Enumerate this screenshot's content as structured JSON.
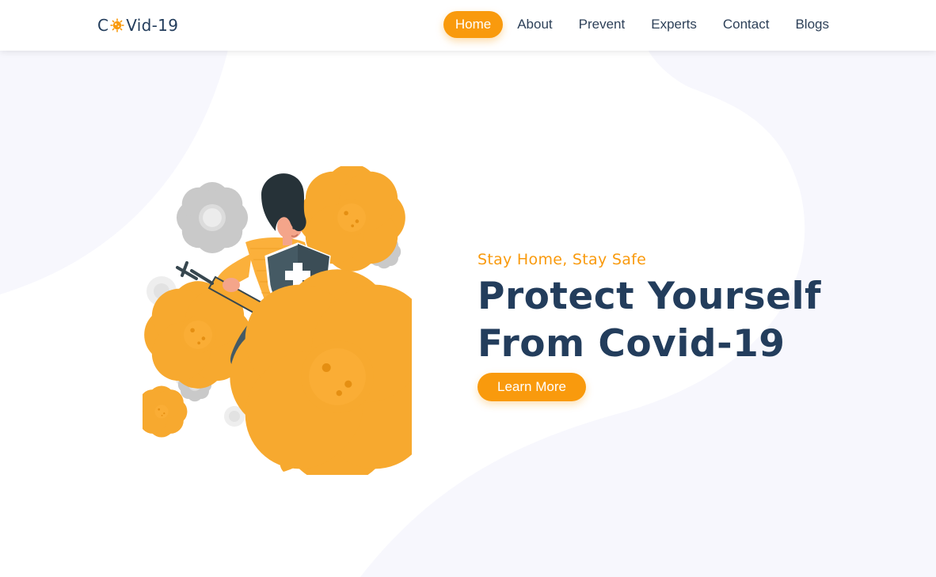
{
  "colors": {
    "accent": "#f99a0d",
    "navy": "#233d5c",
    "blob": "#f7f7fd"
  },
  "logo": {
    "prefix": "C",
    "suffix": "Vid-19",
    "icon": "virus-icon"
  },
  "nav": {
    "items": [
      {
        "label": "Home",
        "active": true
      },
      {
        "label": "About",
        "active": false
      },
      {
        "label": "Prevent",
        "active": false
      },
      {
        "label": "Experts",
        "active": false
      },
      {
        "label": "Contact",
        "active": false
      },
      {
        "label": "Blogs",
        "active": false
      }
    ]
  },
  "hero": {
    "tagline": "Stay Home, Stay Safe",
    "headline_line1": "Protect Yourself",
    "headline_line2": "From Covid-19",
    "cta_label": "Learn More",
    "illustration": "woman-with-syringe-and-shield-fighting-viruses-illustration"
  }
}
